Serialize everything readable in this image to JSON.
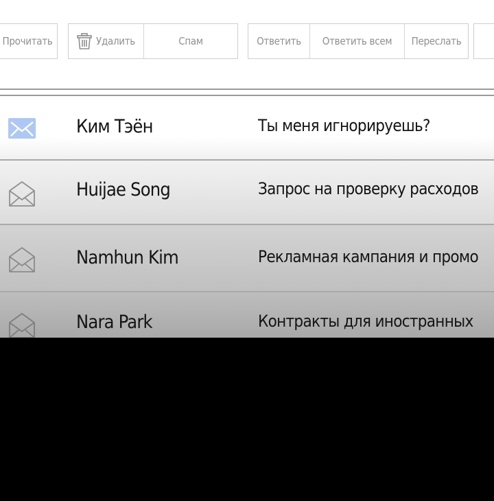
{
  "toolbar": {
    "read_label": "Прочитать",
    "delete_label": "Удалить",
    "spam_label": "Спам",
    "reply_label": "Ответить",
    "reply_all_label": "Ответить всем",
    "forward_label": "Переслать"
  },
  "messages": [
    {
      "sender": "Ким Тэён",
      "subject": "Ты меня игнорируешь?",
      "status": "unread",
      "icon": "mail-closed-icon"
    },
    {
      "sender": "Huijae Song",
      "subject": "Запрос на проверку расходов",
      "status": "read",
      "icon": "mail-open-icon"
    },
    {
      "sender": "Namhun Kim",
      "subject": "Рекламная кампания и промо",
      "status": "read",
      "icon": "mail-open-icon"
    },
    {
      "sender": "Nara Park",
      "subject": "Контракты для иностранных",
      "status": "read",
      "icon": "mail-open-icon"
    }
  ],
  "colors": {
    "unread_icon": "#aec8f3",
    "read_icon_stroke": "#8f8f8f",
    "button_text": "#8f8f8f",
    "list_text": "#141414"
  }
}
